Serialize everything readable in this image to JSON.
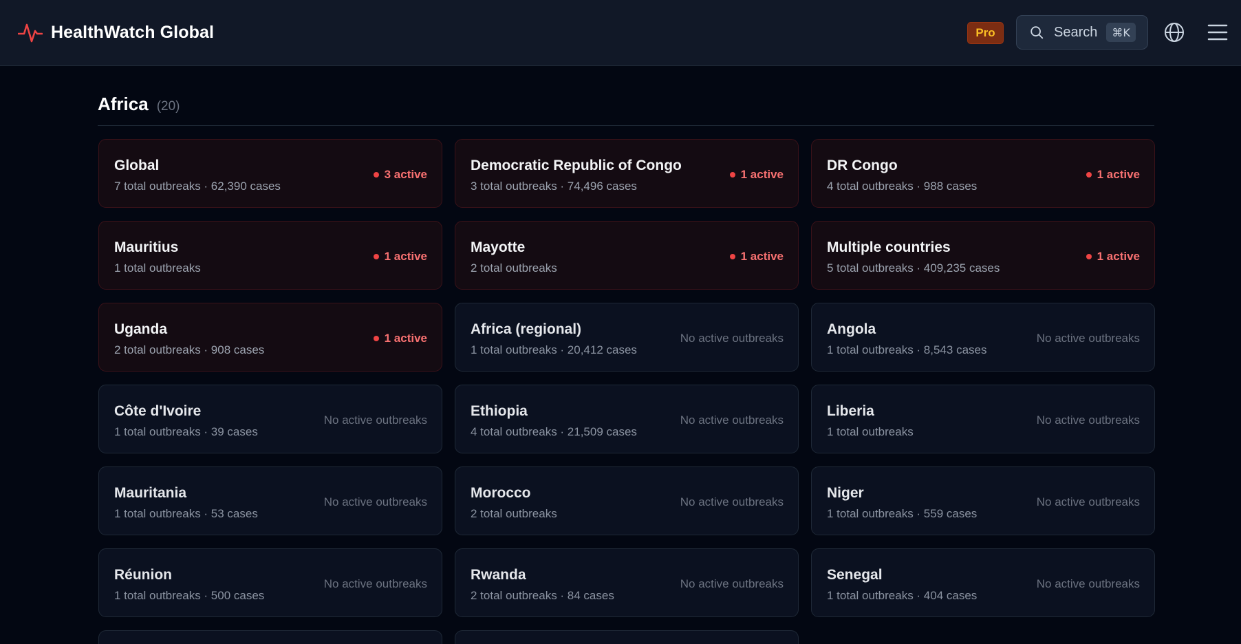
{
  "header": {
    "app_title": "HealthWatch Global",
    "brand_icon": "pulse-icon",
    "pro_label": "Pro",
    "search_label": "Search",
    "search_shortcut": "⌘K",
    "globe_icon": "globe-icon",
    "menu_icon": "menu-icon"
  },
  "colors": {
    "accent_red": "#ef4444",
    "pro_text": "#fbbf24",
    "background": "#030712"
  },
  "section": {
    "title": "Africa",
    "count": "(20)"
  },
  "cards": [
    {
      "name": "Global",
      "stats": "7 total outbreaks · 62,390 cases",
      "status": "3 active",
      "active": true
    },
    {
      "name": "Democratic Republic of Congo",
      "stats": "3 total outbreaks · 74,496 cases",
      "status": "1 active",
      "active": true
    },
    {
      "name": "DR Congo",
      "stats": "4 total outbreaks · 988 cases",
      "status": "1 active",
      "active": true
    },
    {
      "name": "Mauritius",
      "stats": "1 total outbreaks",
      "status": "1 active",
      "active": true
    },
    {
      "name": "Mayotte",
      "stats": "2 total outbreaks",
      "status": "1 active",
      "active": true
    },
    {
      "name": "Multiple countries",
      "stats": "5 total outbreaks · 409,235 cases",
      "status": "1 active",
      "active": true
    },
    {
      "name": "Uganda",
      "stats": "2 total outbreaks · 908 cases",
      "status": "1 active",
      "active": true
    },
    {
      "name": "Africa (regional)",
      "stats": "1 total outbreaks · 20,412 cases",
      "status": "No active outbreaks",
      "active": false
    },
    {
      "name": "Angola",
      "stats": "1 total outbreaks · 8,543 cases",
      "status": "No active outbreaks",
      "active": false
    },
    {
      "name": "Côte d'Ivoire",
      "stats": "1 total outbreaks · 39 cases",
      "status": "No active outbreaks",
      "active": false
    },
    {
      "name": "Ethiopia",
      "stats": "4 total outbreaks · 21,509 cases",
      "status": "No active outbreaks",
      "active": false
    },
    {
      "name": "Liberia",
      "stats": "1 total outbreaks",
      "status": "No active outbreaks",
      "active": false
    },
    {
      "name": "Mauritania",
      "stats": "1 total outbreaks · 53 cases",
      "status": "No active outbreaks",
      "active": false
    },
    {
      "name": "Morocco",
      "stats": "2 total outbreaks",
      "status": "No active outbreaks",
      "active": false
    },
    {
      "name": "Niger",
      "stats": "1 total outbreaks · 559 cases",
      "status": "No active outbreaks",
      "active": false
    },
    {
      "name": "Réunion",
      "stats": "1 total outbreaks · 500 cases",
      "status": "No active outbreaks",
      "active": false
    },
    {
      "name": "Rwanda",
      "stats": "2 total outbreaks · 84 cases",
      "status": "No active outbreaks",
      "active": false
    },
    {
      "name": "Senegal",
      "stats": "1 total outbreaks · 404 cases",
      "status": "No active outbreaks",
      "active": false
    }
  ]
}
